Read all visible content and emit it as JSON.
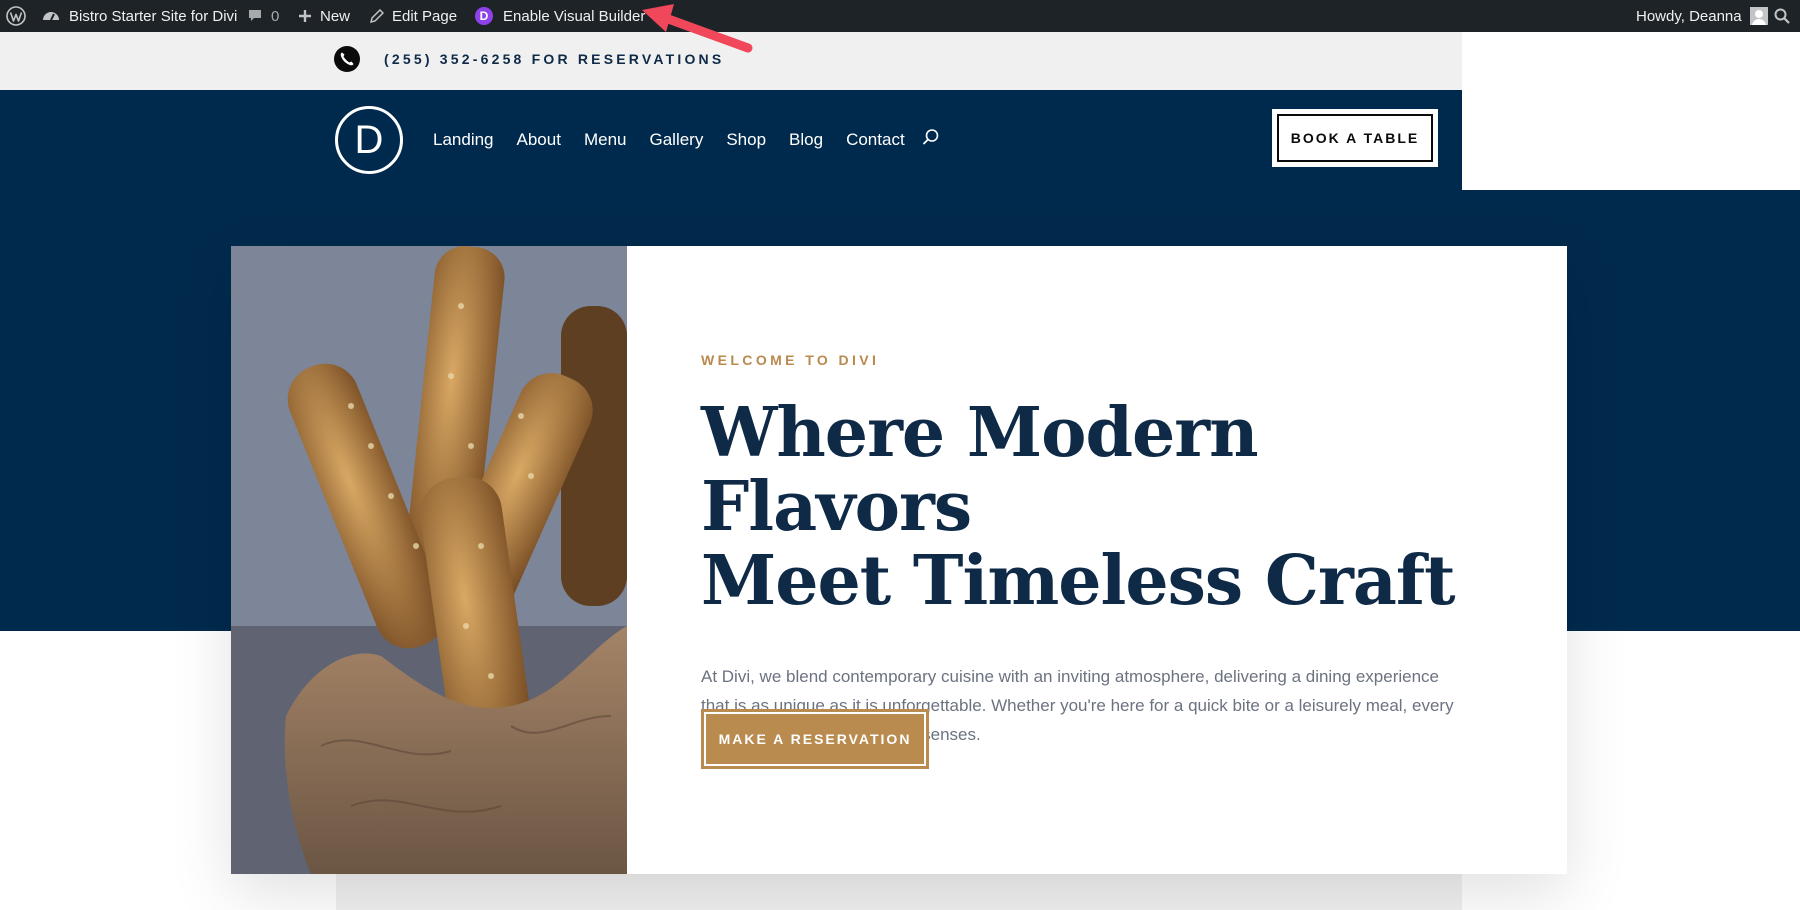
{
  "adminbar": {
    "site_name": "Bistro Starter Site for Divi",
    "comments_count": "0",
    "new_label": "New",
    "edit_label": "Edit Page",
    "divi_letter": "D",
    "visual_builder_label": "Enable Visual Builder",
    "greeting": "Howdy, Deanna"
  },
  "topbar": {
    "phone_text": "(255) 352-6258 FOR RESERVATIONS"
  },
  "header": {
    "logo_letter": "D",
    "nav": [
      "Landing",
      "About",
      "Menu",
      "Gallery",
      "Shop",
      "Blog",
      "Contact"
    ],
    "book_label": "BOOK A TABLE"
  },
  "hero": {
    "eyebrow": "WELCOME TO DIVI",
    "headline_line1": "Where Modern Flavors",
    "headline_line2": "Meet Timeless Craft",
    "intro": "At Divi, we blend contemporary cuisine with an inviting atmosphere, delivering a dining experience that is as unique as it is unforgettable. Whether you're here for a quick bite or a leisurely meal, every dish is crafted to delight your senses.",
    "cta_label": "MAKE A RESERVATION"
  },
  "colors": {
    "navy": "#002a4d",
    "gold": "#b98b4f",
    "admin_bar": "#1d2327",
    "annotation_arrow": "#f0475a"
  }
}
